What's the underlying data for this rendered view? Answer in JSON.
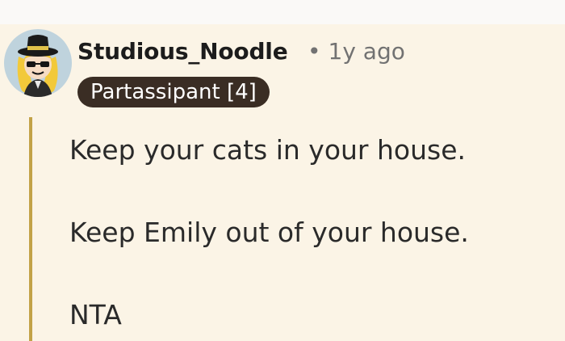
{
  "comment": {
    "author": "Studious_Noodle",
    "separator": "•",
    "age": "1y ago",
    "flair": "Partassipant [4]",
    "body_lines": [
      "Keep your cats in your house.",
      "Keep Emily out of your house.",
      "NTA"
    ]
  },
  "colors": {
    "panel_background": "#fbf4e6",
    "thread_line": "#c2a247",
    "flair_background": "#3a2d24"
  },
  "icons": {
    "avatar": "avatar-illustration"
  }
}
